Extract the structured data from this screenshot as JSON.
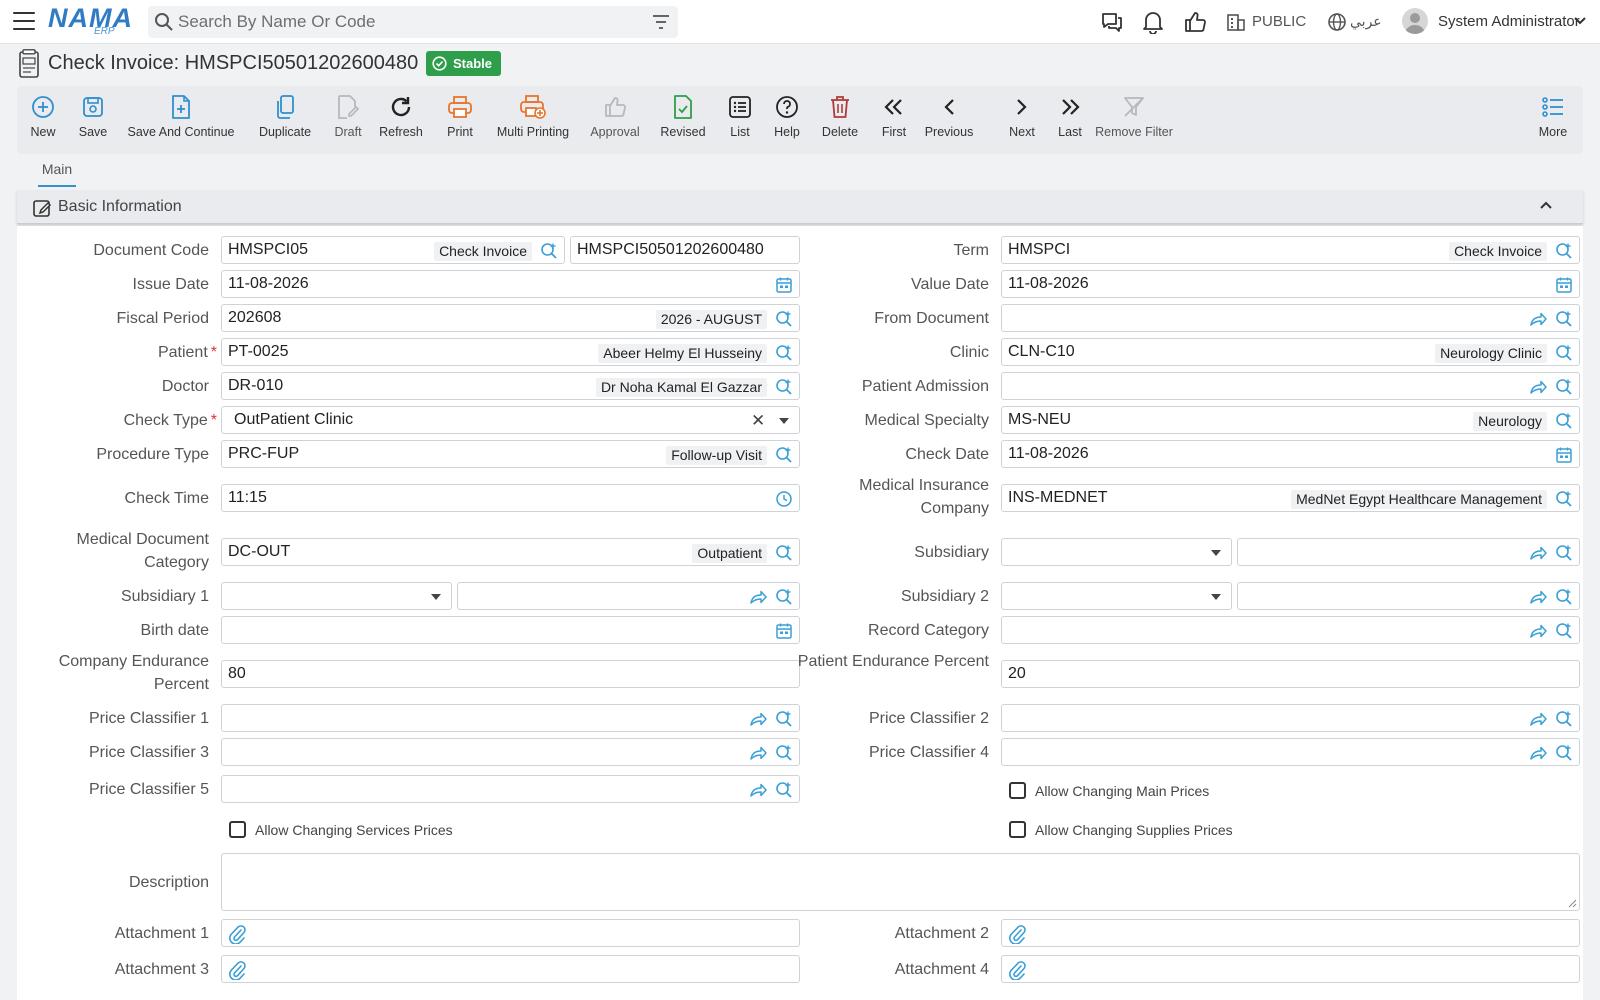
{
  "search": {
    "placeholder": "Search By Name Or Code"
  },
  "header": {
    "public_label": "PUBLIC",
    "language_label": "عربي",
    "user_name": "System Administrator"
  },
  "page": {
    "title": "Check Invoice: HMSPCI50501202600480",
    "status": "Stable"
  },
  "toolbar": {
    "new": "New",
    "save": "Save",
    "save_continue": "Save And Continue",
    "duplicate": "Duplicate",
    "draft": "Draft",
    "refresh": "Refresh",
    "print": "Print",
    "multi_printing": "Multi Printing",
    "approval": "Approval",
    "revised": "Revised",
    "list": "List",
    "help": "Help",
    "delete": "Delete",
    "first": "First",
    "previous": "Previous",
    "next": "Next",
    "last": "Last",
    "remove_filter": "Remove Filter",
    "more": "More"
  },
  "tabs": {
    "main": "Main"
  },
  "section": {
    "title": "Basic Information"
  },
  "labels": {
    "document_code": "Document Code",
    "issue_date": "Issue Date",
    "fiscal_period": "Fiscal Period",
    "patient": "Patient",
    "doctor": "Doctor",
    "check_type": "Check Type",
    "procedure_type": "Procedure Type",
    "check_time": "Check Time",
    "medical_document_category": "Medical Document Category",
    "subsidiary_1": "Subsidiary 1",
    "birth_date": "Birth date",
    "company_endurance_percent": "Company Endurance Percent",
    "price_classifier_1": "Price Classifier 1",
    "price_classifier_3": "Price Classifier 3",
    "price_classifier_5": "Price Classifier 5",
    "term": "Term",
    "value_date": "Value Date",
    "from_document": "From Document",
    "clinic": "Clinic",
    "patient_admission": "Patient Admission",
    "medical_specialty": "Medical Specialty",
    "check_date": "Check Date",
    "medical_insurance_company": "Medical Insurance Company",
    "subsidiary": "Subsidiary",
    "subsidiary_2": "Subsidiary 2",
    "record_category": "Record Category",
    "patient_endurance_percent": "Patient Endurance Percent",
    "price_classifier_2": "Price Classifier 2",
    "price_classifier_4": "Price Classifier 4",
    "description": "Description",
    "attachment_1": "Attachment 1",
    "attachment_2": "Attachment 2",
    "attachment_3": "Attachment 3",
    "attachment_4": "Attachment 4"
  },
  "values": {
    "document_code": "HMSPCI05",
    "document_code_desc": "Check Invoice",
    "document_number": "HMSPCI50501202600480",
    "issue_date": "11-08-2026",
    "fiscal_period": "202608",
    "fiscal_period_desc": "2026 - AUGUST",
    "patient": "PT-0025",
    "patient_desc": "Abeer Helmy El Husseiny",
    "doctor": "DR-010",
    "doctor_desc": "Dr Noha Kamal El Gazzar",
    "check_type": "OutPatient Clinic",
    "procedure_type": "PRC-FUP",
    "procedure_type_desc": "Follow-up Visit",
    "check_time": "11:15",
    "medical_document_category": "DC-OUT",
    "medical_document_category_desc": "Outpatient",
    "company_endurance_percent": "80",
    "term": "HMSPCI",
    "term_desc": "Check Invoice",
    "value_date": "11-08-2026",
    "clinic": "CLN-C10",
    "clinic_desc": "Neurology Clinic",
    "medical_specialty": "MS-NEU",
    "medical_specialty_desc": "Neurology",
    "check_date": "11-08-2026",
    "medical_insurance_company": "INS-MEDNET",
    "medical_insurance_company_desc": "MedNet Egypt Healthcare Management",
    "patient_endurance_percent": "20"
  },
  "checkboxes": {
    "allow_changing_main_prices": "Allow Changing Main Prices",
    "allow_changing_services_prices": "Allow Changing Services Prices",
    "allow_changing_supplies_prices": "Allow Changing Supplies Prices"
  },
  "icons": {
    "menu": "hamburger-icon",
    "search": "search-icon",
    "filter": "filter-icon",
    "chat": "chat-icon",
    "notifications": "bell-icon",
    "like": "thumbs-up-icon",
    "company": "building-icon",
    "language": "globe-icon",
    "user": "user-avatar-icon",
    "lookup": "search-plus-icon",
    "navigate": "share-arrow-icon",
    "calendar": "calendar-icon",
    "clock": "clock-icon",
    "attachment": "paperclip-icon"
  },
  "colors": {
    "accent": "#2f7cc4",
    "icon_blue": "#3a9fd6",
    "status_green": "#2e9e4b",
    "print_orange": "#e8752b",
    "delete_red": "#b03a3a",
    "required_red": "#d9333a"
  }
}
